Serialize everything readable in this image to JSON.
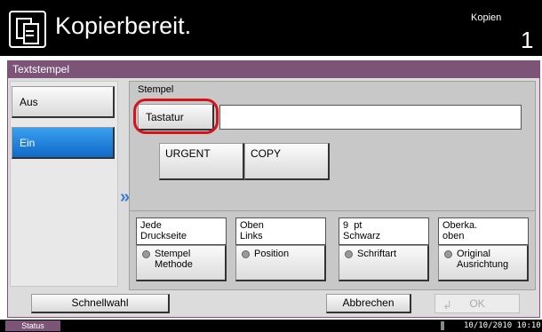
{
  "header": {
    "title": "Kopierbereit.",
    "copies_label": "Kopien",
    "copies_count": "1"
  },
  "panel": {
    "title": "Textstempel",
    "options": [
      {
        "label": "Aus",
        "selected": false
      },
      {
        "label": "Ein",
        "selected": true
      }
    ],
    "stempel_label": "Stempel",
    "keyboard_button": "Tastatur",
    "text_value": "",
    "presets": [
      "URGENT",
      "COPY"
    ],
    "settings": [
      {
        "value": "Jede\nDruckseite",
        "action": "Stempel\nMethode"
      },
      {
        "value": "Oben\nLinks",
        "action": "Position"
      },
      {
        "value": "9  pt\nSchwarz",
        "action": "Schriftart"
      },
      {
        "value": "Oberka.\noben",
        "action": "Original\nAusrichtung"
      }
    ]
  },
  "footer": {
    "quick_setup": "Schnellwahl",
    "cancel": "Abbrechen",
    "ok": "OK"
  },
  "statusbar": {
    "status": "Status",
    "datetime": "10/10/2010  10:10"
  },
  "colors": {
    "accent": "#7b5478",
    "selected": "#1a7fdc",
    "highlight": "#d4141b"
  }
}
